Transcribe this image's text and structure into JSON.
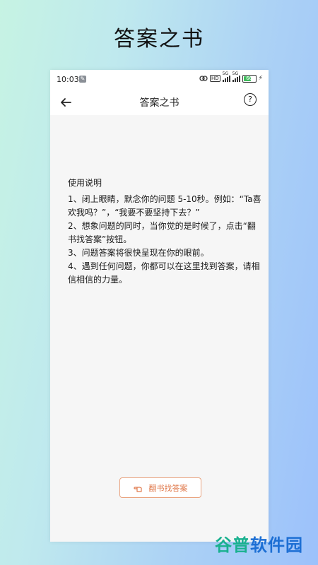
{
  "banner": {
    "title": "答案之书"
  },
  "status_bar": {
    "time": "10:03",
    "hd": "HD",
    "sig1_label": "5G",
    "sig2_label": "5G",
    "battery": "66",
    "icons": [
      "app-notification-icon",
      "link-icon",
      "signal-icon",
      "battery-icon",
      "charging-bolt-icon"
    ]
  },
  "app_bar": {
    "title": "答案之书",
    "help": "?"
  },
  "instructions": {
    "heading": "使用说明",
    "items": [
      "1、闭上眼睛，默念你的问题 5-10秒。例如：“Ta喜欢我吗？”，“我要不要坚持下去？”",
      "2、想象问题的同时，当你觉的是时候了，点击“翻书找答案”按钮。",
      "3、问题答案将很快呈现在你的眼前。",
      "4、遇到任何问题，你都可以在这里找到答案，请相信相信的力量。"
    ]
  },
  "action": {
    "label": "翻书找答案",
    "accent": "#e07a4d"
  },
  "watermark": {
    "part1": "谷普",
    "part2": "软件园"
  }
}
